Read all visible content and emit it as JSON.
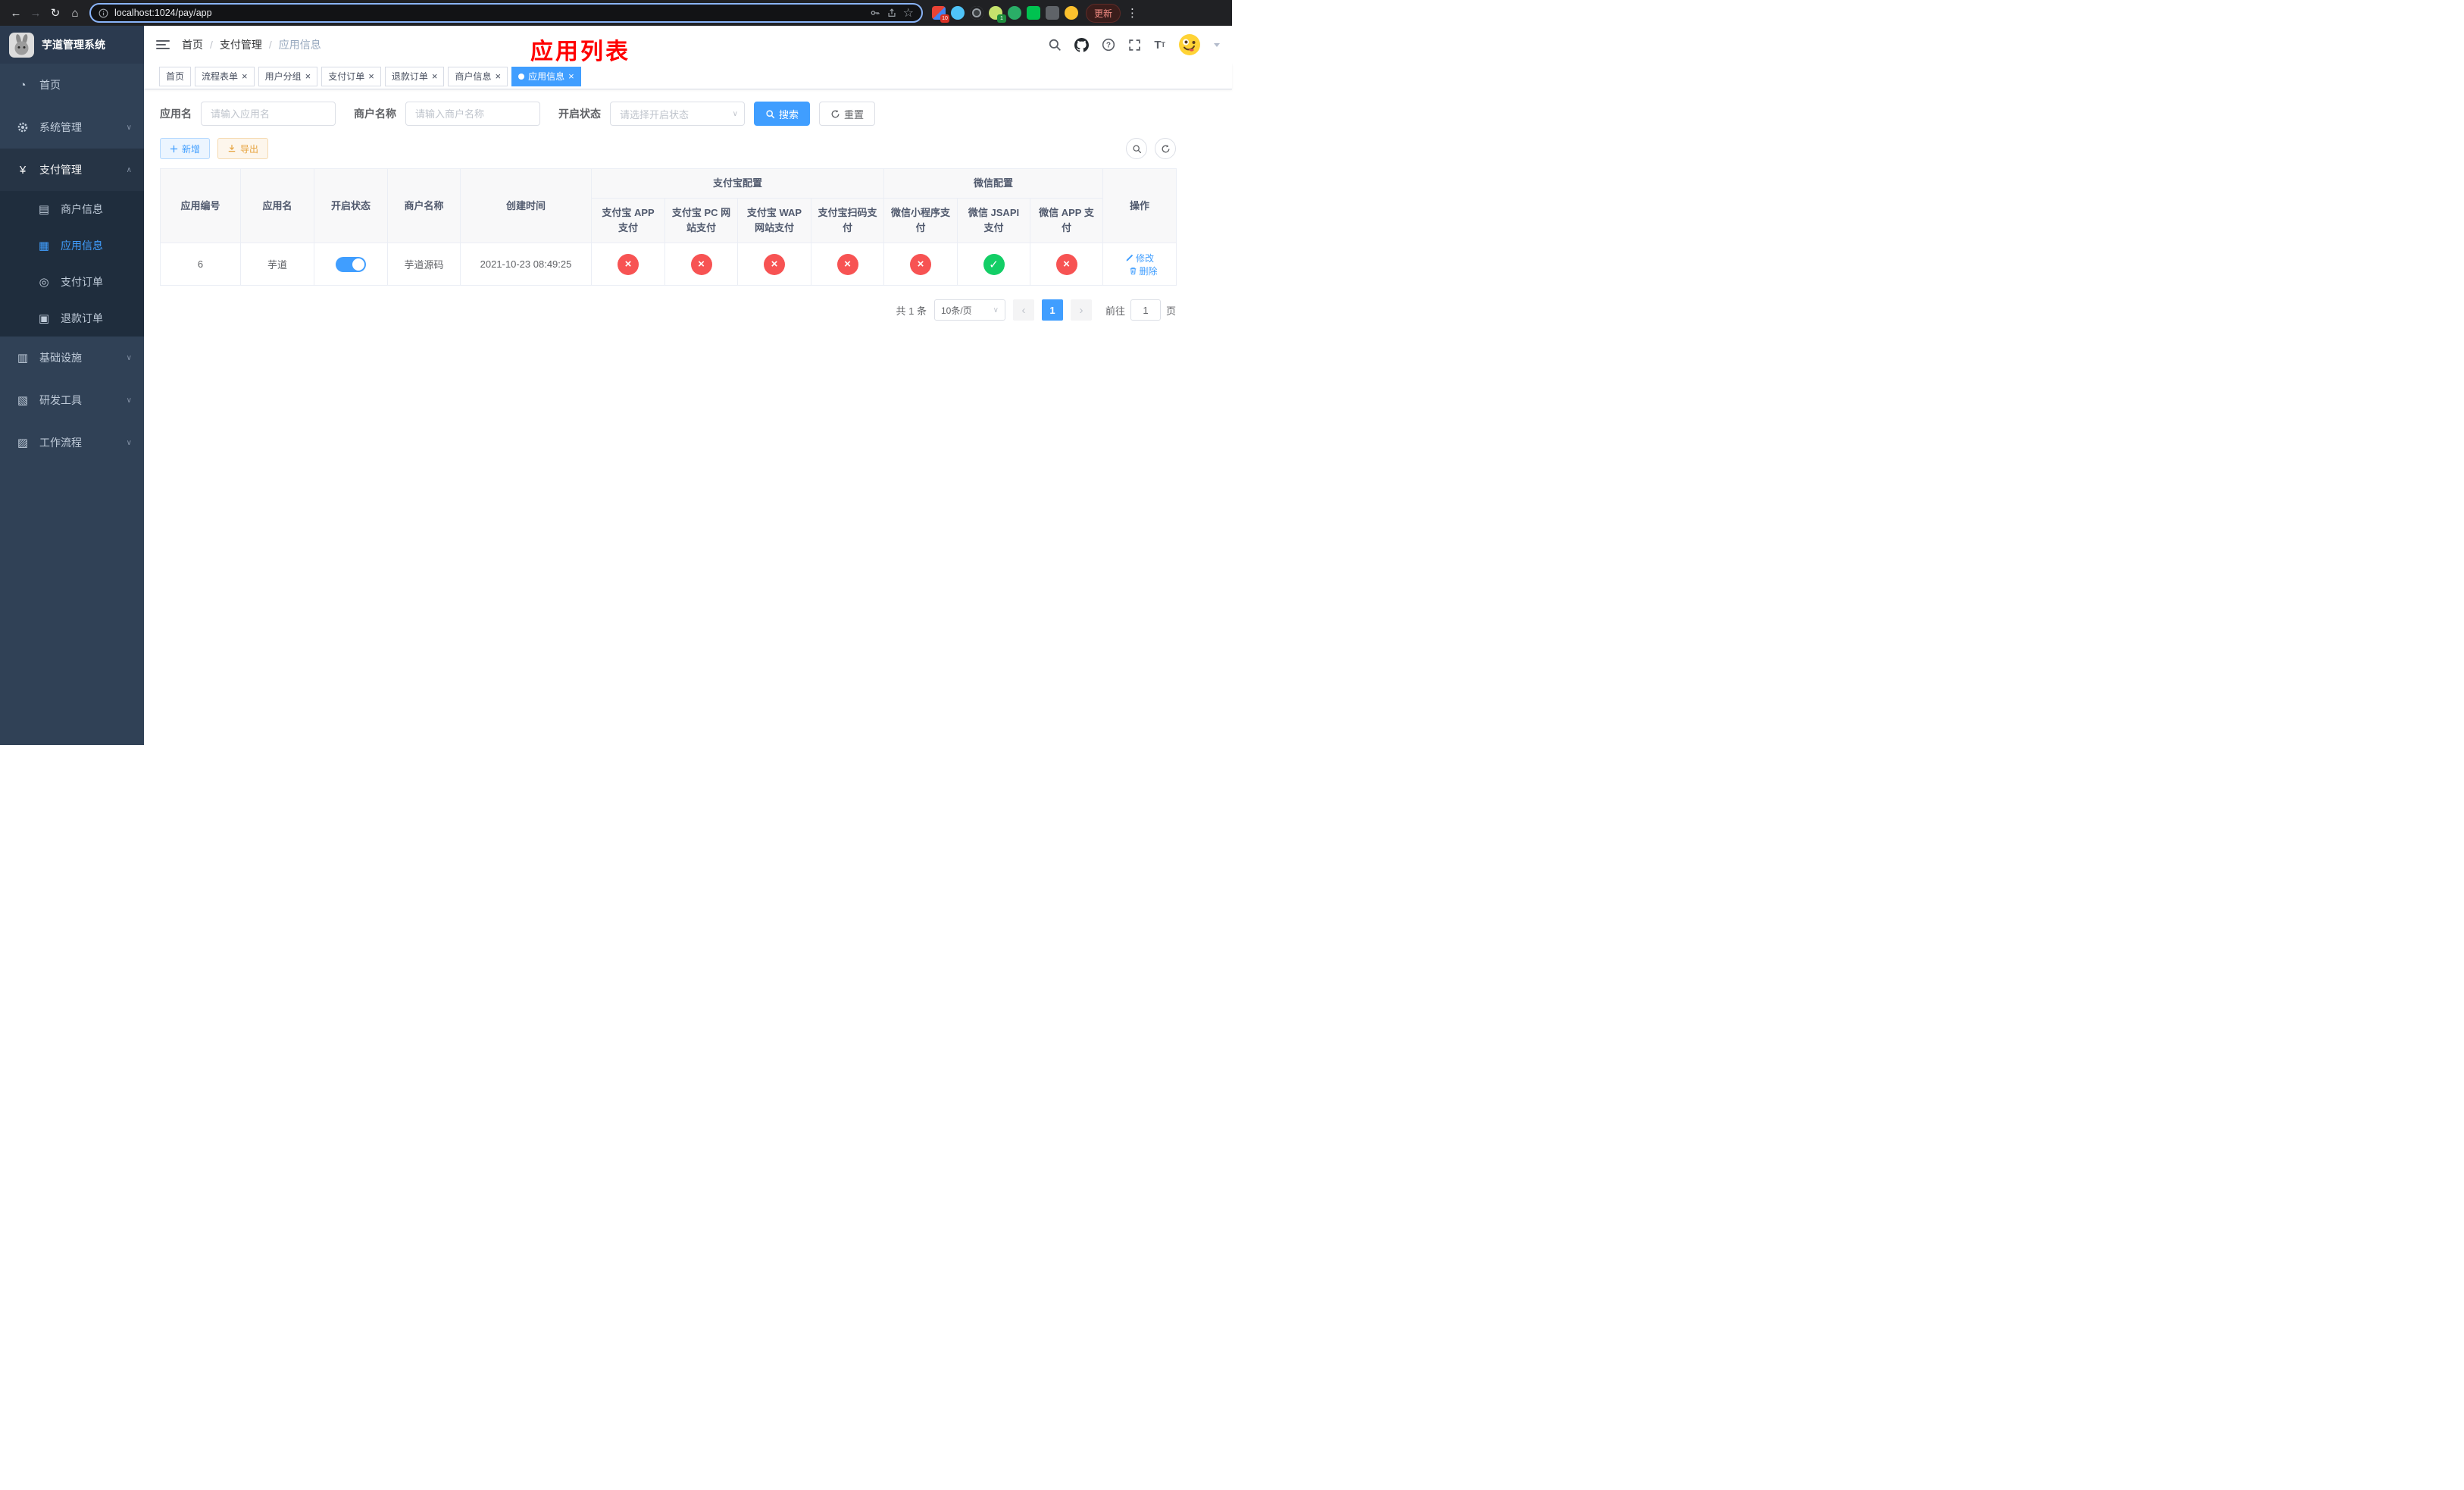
{
  "browser": {
    "url": "localhost:1024/pay/app",
    "update_label": "更新",
    "ext_badges": {
      "first": "10",
      "second": "1"
    }
  },
  "sidebar": {
    "title": "芋道管理系统",
    "items": [
      {
        "label": "首页"
      },
      {
        "label": "系统管理"
      },
      {
        "label": "支付管理",
        "children": [
          {
            "label": "商户信息"
          },
          {
            "label": "应用信息"
          },
          {
            "label": "支付订单"
          },
          {
            "label": "退款订单"
          }
        ]
      },
      {
        "label": "基础设施"
      },
      {
        "label": "研发工具"
      },
      {
        "label": "工作流程"
      }
    ]
  },
  "header": {
    "breadcrumb": [
      "首页",
      "支付管理",
      "应用信息"
    ],
    "annotation": "应用列表"
  },
  "tabs": [
    {
      "label": "首页"
    },
    {
      "label": "流程表单"
    },
    {
      "label": "用户分组"
    },
    {
      "label": "支付订单"
    },
    {
      "label": "退款订单"
    },
    {
      "label": "商户信息"
    },
    {
      "label": "应用信息"
    }
  ],
  "filters": {
    "app_name_label": "应用名",
    "app_name_placeholder": "请输入应用名",
    "merchant_label": "商户名称",
    "merchant_placeholder": "请输入商户名称",
    "status_label": "开启状态",
    "status_placeholder": "请选择开启状态",
    "search_label": "搜索",
    "reset_label": "重置"
  },
  "toolbar": {
    "add_label": "新增",
    "export_label": "导出"
  },
  "table": {
    "groups": {
      "alipay": "支付宝配置",
      "wechat": "微信配置"
    },
    "columns": [
      "应用编号",
      "应用名",
      "开启状态",
      "商户名称",
      "创建时间",
      "支付宝 APP 支付",
      "支付宝 PC 网站支付",
      "支付宝 WAP 网站支付",
      "支付宝扫码支付",
      "微信小程序支付",
      "微信 JSAPI 支付",
      "微信 APP 支付",
      "操作"
    ],
    "actions": {
      "edit": "修改",
      "delete": "删除"
    },
    "rows": [
      {
        "id": "6",
        "name": "芋道",
        "enabled": true,
        "merchant": "芋道源码",
        "create_time": "2021-10-23 08:49:25",
        "alipay_app": false,
        "alipay_pc": false,
        "alipay_wap": false,
        "alipay_qr": false,
        "wechat_mini": false,
        "wechat_jsapi": true,
        "wechat_app": false
      }
    ]
  },
  "pagination": {
    "total": "共 1 条",
    "page_size": "10条/页",
    "page": "1",
    "goto_label": "前往",
    "goto_value": "1",
    "goto_unit": "页"
  },
  "colors": {
    "accent": "#409eff",
    "danger": "#f75353",
    "success": "#13ce66",
    "annotation": "#ff0000",
    "sidebar_bg": "#304156"
  }
}
